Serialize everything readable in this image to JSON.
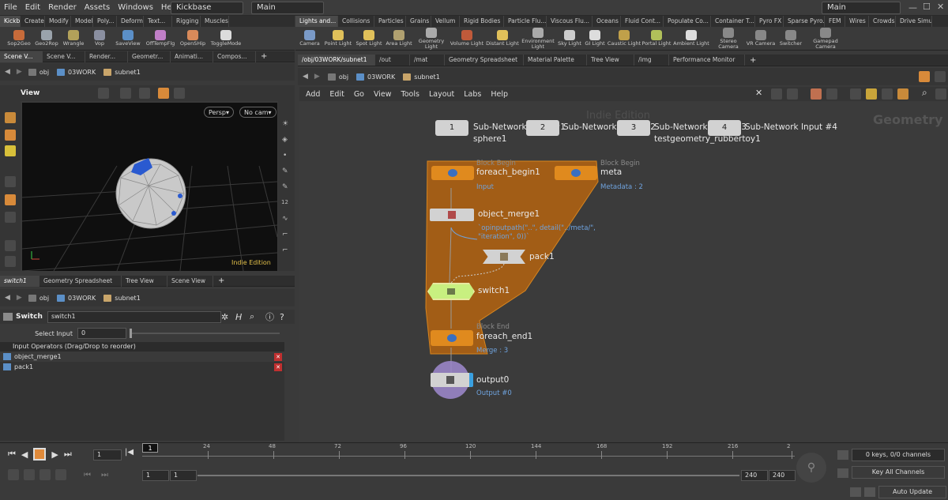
{
  "menu": [
    "File",
    "Edit",
    "Render",
    "Assets",
    "Windows",
    "Help"
  ],
  "desktop": "Kickbase",
  "context": "Main",
  "context_right": "Main",
  "shelf_tabs_left": [
    "Kickb...",
    "Create",
    "Modify",
    "Model",
    "Poly...",
    "Deform",
    "Text...",
    "Rigging",
    "Muscles"
  ],
  "shelf_tools_left": [
    "Sop2Geo",
    "Geo2Rop",
    "Wrangle",
    "Vop",
    "SaveView",
    "OffTempFlg",
    "OpenSHip",
    "ToggleMode"
  ],
  "shelf_tabs_right": [
    "Lights and...",
    "Collisions",
    "Particles",
    "Grains",
    "Vellum",
    "Rigid Bodies",
    "Particle Flu...",
    "Viscous Flu...",
    "Oceans",
    "Fluid Cont...",
    "Populate Co...",
    "Container T...",
    "Pyro FX",
    "Sparse Pyro...",
    "FEM",
    "Wires",
    "Crowds",
    "Drive Simu..."
  ],
  "shelf_tools_right": [
    "Camera",
    "Point Light",
    "Spot Light",
    "Area Light",
    "Geometry Light",
    "Volume Light",
    "Distant Light",
    "Environment Light",
    "Sky Light",
    "GI Light",
    "Caustic Light",
    "Portal Light",
    "Ambient Light",
    "Stereo Camera",
    "VR Camera",
    "Switcher",
    "Gamepad Camera"
  ],
  "left_top_tabs": [
    "Scene V...",
    "Scene V...",
    "Render...",
    "Geometr...",
    "Animati...",
    "Compos..."
  ],
  "path_obj": "obj",
  "path_work": "03WORK",
  "path_subnet": "subnet1",
  "viewport": {
    "title": "View",
    "persp": "Persp",
    "cam": "No cam",
    "watermark": "Indie Edition"
  },
  "left_bottom_tabs": [
    "switch1",
    "Geometry Spreadsheet",
    "Tree View",
    "Scene View"
  ],
  "params": {
    "type": "Switch",
    "name": "switch1",
    "select_label": "Select Input",
    "select_value": "0",
    "list_header": "Input Operators (Drag/Drop to reorder)",
    "inputs": [
      "object_merge1",
      "pack1"
    ]
  },
  "right_tabs": [
    "/obj/03WORK/subnet1",
    "/out",
    "/mat",
    "Geometry Spreadsheet",
    "Material Palette",
    "Tree View",
    "/img",
    "Performance Monitor"
  ],
  "net_menu": [
    "Add",
    "Edit",
    "Go",
    "View",
    "Tools",
    "Layout",
    "Labs",
    "Help"
  ],
  "net": {
    "watermark": "Indie Edition",
    "context_label": "Geometry",
    "subnet_inputs": [
      {
        "num": "1",
        "name": "Sub-Network Input #1",
        "sub": "sphere1"
      },
      {
        "num": "2",
        "name": "Sub-Network Input #2",
        "sub": ""
      },
      {
        "num": "3",
        "name": "Sub-Network Input #3",
        "sub": "testgeometry_rubbertoy1"
      },
      {
        "num": "4",
        "name": "Sub-Network Input #4",
        "sub": ""
      }
    ],
    "foreach_begin": {
      "tag": "Block Begin",
      "name": "foreach_begin1",
      "sub": "Input"
    },
    "meta": {
      "tag": "Block Begin",
      "name": "meta",
      "sub": "Metadata : 2"
    },
    "object_merge": {
      "name": "object_merge1",
      "expr": "`opinputpath(\"..\", detail(\"../meta/\", \"iteration\", 0))`"
    },
    "pack": {
      "name": "pack1"
    },
    "switch": {
      "name": "switch1"
    },
    "foreach_end": {
      "tag": "Block End",
      "name": "foreach_end1",
      "sub": "Merge : 3"
    },
    "output": {
      "name": "output0",
      "sub": "Output #0"
    }
  },
  "timeline": {
    "frame": "1",
    "ticks": [
      "24",
      "48",
      "72",
      "96",
      "120",
      "144",
      "168",
      "192",
      "216",
      "2"
    ],
    "start": "1",
    "start2": "1",
    "end": "240",
    "end2": "240",
    "keys": "0 keys, 0/0 channels",
    "key_all": "Key All Channels",
    "auto_update": "Auto Update"
  },
  "colors": {
    "orange": "#e08a1e",
    "block": "#a85f15",
    "switch": "#c8f080",
    "output_ring": "#9a86c8",
    "blue_text": "#6fa3de"
  }
}
